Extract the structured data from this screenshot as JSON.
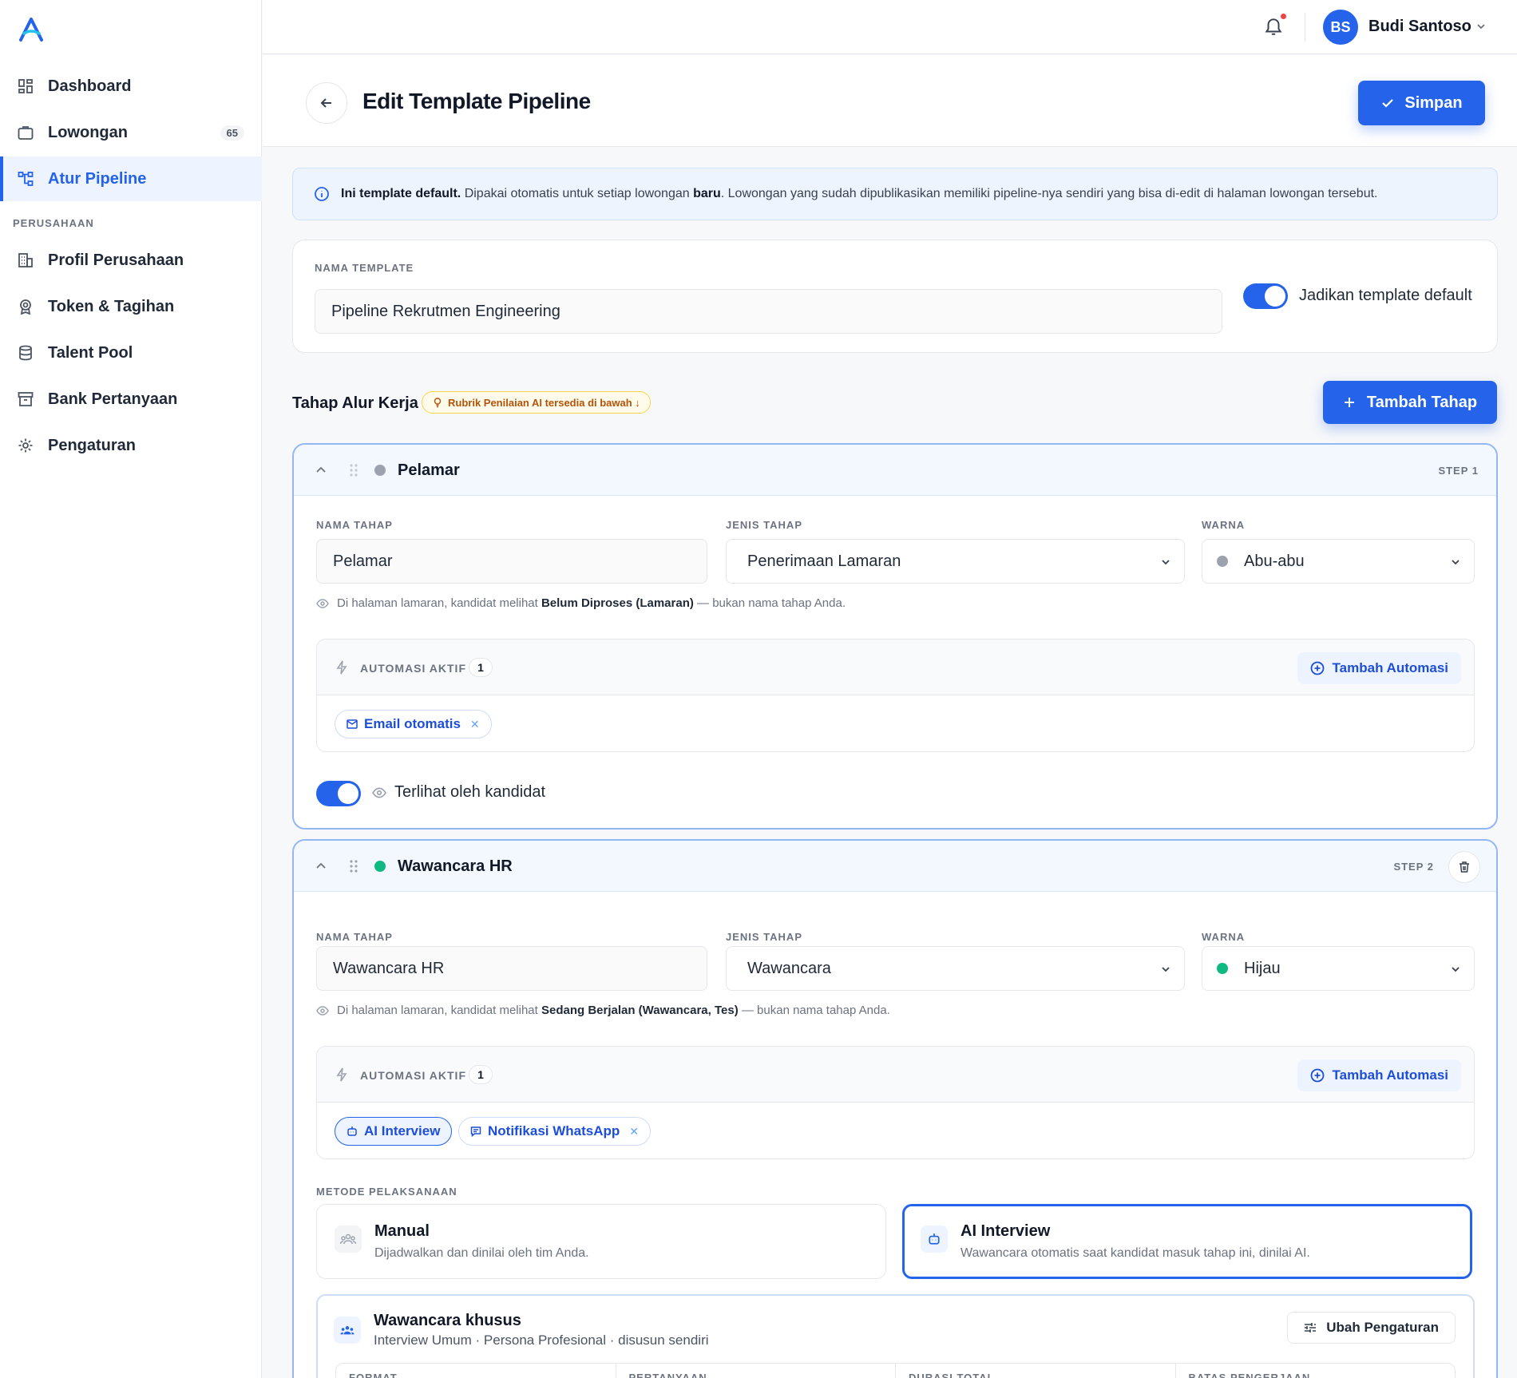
{
  "sidebar": {
    "items": [
      {
        "label": "Dashboard",
        "icon": "dashboard-icon"
      },
      {
        "label": "Lowongan",
        "icon": "briefcase-icon",
        "badge": "65"
      },
      {
        "label": "Atur Pipeline",
        "icon": "pipeline-icon",
        "active": true
      },
      {
        "label": "Profil Perusahaan",
        "icon": "building-icon"
      },
      {
        "label": "Token & Tagihan",
        "icon": "award-icon"
      },
      {
        "label": "Talent Pool",
        "icon": "database-icon"
      },
      {
        "label": "Bank Pertanyaan",
        "icon": "archive-icon"
      },
      {
        "label": "Pengaturan",
        "icon": "gear-icon"
      }
    ],
    "section_label": "PERUSAHAAN"
  },
  "topbar": {
    "user_initials": "BS",
    "user_name": "Budi Santoso"
  },
  "header": {
    "title": "Edit Template Pipeline",
    "save_label": "Simpan"
  },
  "info_banner": {
    "bold_1": "Ini template default.",
    "text_1": " Dipakai otomatis untuk setiap lowongan ",
    "bold_2": "baru",
    "text_2": ". Lowongan yang sudah dipublikasikan memiliki pipeline-nya sendiri yang bisa di-edit di halaman lowongan tersebut."
  },
  "template": {
    "name_label": "NAMA TEMPLATE",
    "name_value": "Pipeline Rekrutmen Engineering",
    "default_toggle_label": "Jadikan template default",
    "default_toggle_on": true
  },
  "workflow": {
    "title": "Tahap Alur Kerja",
    "rubrik_badge": "Rubrik Penilaian AI tersedia di bawah ↓",
    "add_stage_label": "Tambah Tahap"
  },
  "labels": {
    "stage_name": "NAMA TAHAP",
    "stage_type": "JENIS TAHAP",
    "color": "WARNA",
    "automation_active": "AUTOMASI AKTIF",
    "add_automation": "Tambah Automasi",
    "hint_prefix": "Di halaman lamaran, kandidat melihat ",
    "hint_suffix": " — bukan nama tahap Anda.",
    "visible_to_candidate": "Terlihat oleh kandidat",
    "method": "METODE PELAKSANAAN"
  },
  "stages": [
    {
      "name": "Pelamar",
      "step": "STEP 1",
      "dot_color": "#9ca3af",
      "name_value": "Pelamar",
      "type_value": "Penerimaan Lamaran",
      "color_value": "Abu-abu",
      "candidate_sees": "Belum Diproses (Lamaran)",
      "automation_count": "1",
      "automations": [
        {
          "label": "Email otomatis",
          "icon": "mail-icon"
        }
      ],
      "visible": true
    },
    {
      "name": "Wawancara HR",
      "step": "STEP 2",
      "dot_color": "#10b981",
      "name_value": "Wawancara HR",
      "type_value": "Wawancara",
      "color_value": "Hijau",
      "candidate_sees": "Sedang Berjalan (Wawancara, Tes)",
      "automation_count": "1",
      "automations": [
        {
          "label": "AI Interview",
          "icon": "robot-icon"
        },
        {
          "label": "Notifikasi WhatsApp",
          "icon": "message-icon"
        }
      ],
      "methods": [
        {
          "title": "Manual",
          "desc": "Dijadwalkan dan dinilai oleh tim Anda.",
          "selected": false
        },
        {
          "title": "AI Interview",
          "desc": "Wawancara otomatis saat kandidat masuk tahap ini, dinilai AI.",
          "selected": true
        }
      ],
      "custom": {
        "title": "Wawancara khusus",
        "subtitle": "Interview Umum · Persona Profesional · disusun sendiri",
        "edit_label": "Ubah Pengaturan",
        "columns": [
          "FORMAT",
          "PERTANYAAN",
          "DURASI TOTAL",
          "BATAS PENGERJAAN"
        ]
      }
    }
  ],
  "colors": {
    "accent": "#2563eb",
    "bell_dot": "#ef4444"
  }
}
